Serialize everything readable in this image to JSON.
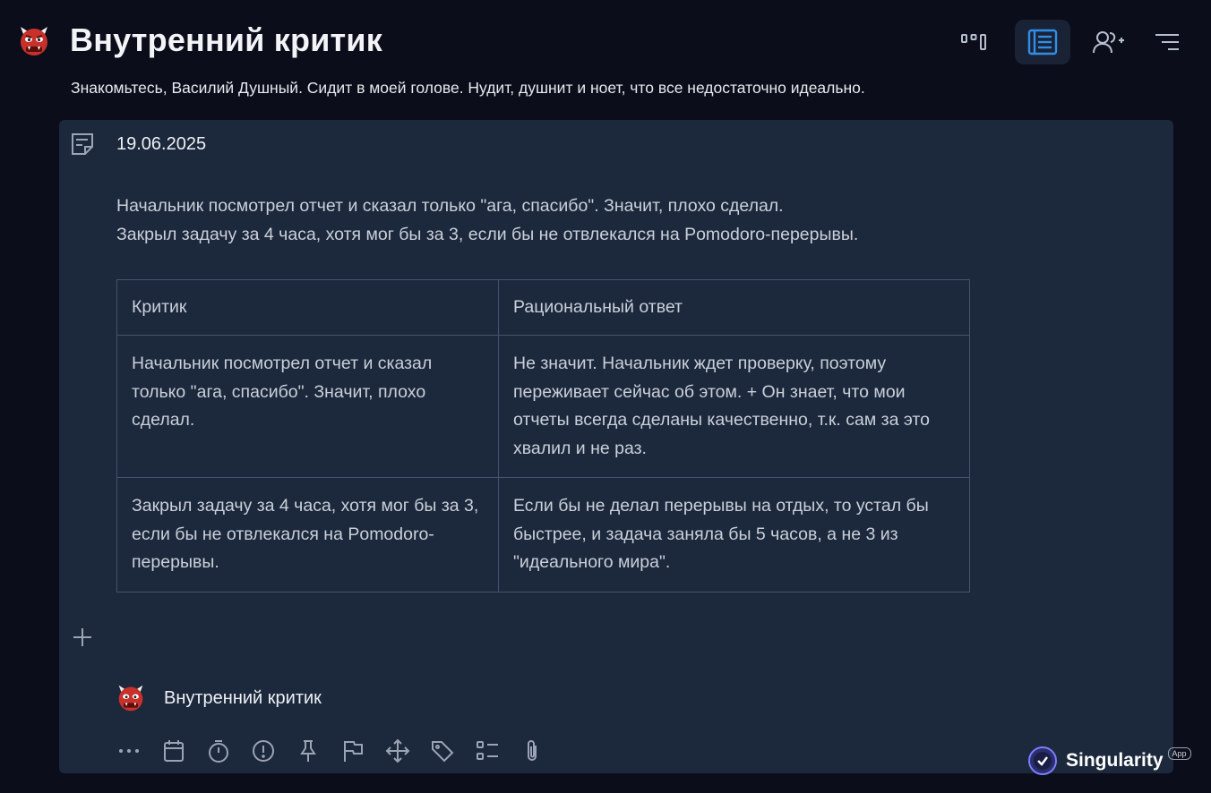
{
  "header": {
    "title": "Внутренний критик",
    "subtitle": "Знакомьтесь, Василий Душный. Сидит в моей голове. Нудит, душнит и ноет, что все недостаточно идеально.",
    "icon": "ogre-icon",
    "buttons": [
      {
        "icon": "kanban-view-icon",
        "active": false
      },
      {
        "icon": "list-view-icon",
        "active": true
      },
      {
        "icon": "add-user-icon",
        "active": false
      },
      {
        "icon": "sort-filter-icon",
        "active": false
      }
    ]
  },
  "note": {
    "date": "19.06.2025",
    "lines": [
      "Начальник посмотрел отчет и сказал только \"ага, спасибо\". Значит, плохо сделал.",
      "Закрыл задачу за 4 часа, хотя мог бы за 3, если бы не отвлекался на Pomodoro-перерывы."
    ],
    "table": {
      "headers": [
        "Критик",
        "Рациональный ответ"
      ],
      "rows": [
        [
          "Начальник посмотрел отчет и сказал только \"ага, спасибо\". Значит, плохо сделал.",
          "Не значит. Начальник ждет проверку, поэтому переживает сейчас об этом. + Он знает, что мои отчеты всегда сделаны качественно, т.к. сам за это хвалил и не раз."
        ],
        [
          "Закрыл задачу за 4 часа, хотя мог бы за 3, если бы не отвлекался на Pomodoro-перерывы.",
          "Если бы не делал перерывы на отдых, то устал бы быстрее, и задача заняла бы 5 часов, а не 3 из \"идеального мира\"."
        ]
      ]
    }
  },
  "author": {
    "name": "Внутренний критик",
    "icon": "ogre-icon"
  },
  "toolbar": [
    "more-icon",
    "calendar-icon",
    "timer-icon",
    "priority-icon",
    "pin-icon",
    "flag-icon",
    "move-icon",
    "tag-icon",
    "checklist-icon",
    "attachment-icon"
  ],
  "brand": {
    "name": "Singularity",
    "badge": "App"
  },
  "colors": {
    "background": "#0b0d1a",
    "card": "#1c283b",
    "accent": "#2f8fe8",
    "border": "#46536a"
  }
}
